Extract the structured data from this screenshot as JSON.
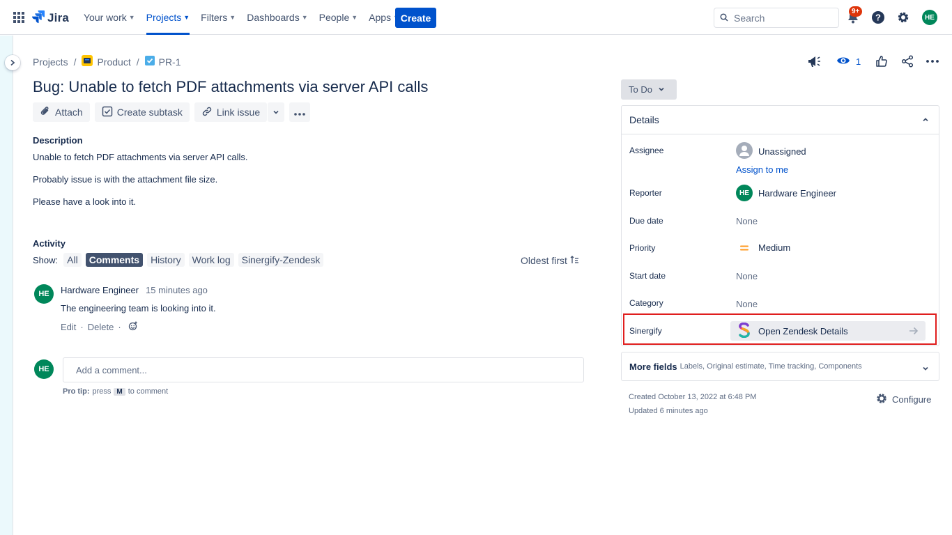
{
  "nav": {
    "logo": "Jira",
    "items": [
      {
        "label": "Your work"
      },
      {
        "label": "Projects"
      },
      {
        "label": "Filters"
      },
      {
        "label": "Dashboards"
      },
      {
        "label": "People"
      },
      {
        "label": "Apps"
      }
    ],
    "create": "Create",
    "search_placeholder": "Search",
    "notification_badge": "9+",
    "user_initials": "HE"
  },
  "breadcrumb": {
    "projects": "Projects",
    "project": "Product",
    "issue_key": "PR-1"
  },
  "issue": {
    "title": "Bug: Unable to fetch PDF attachments via server API calls",
    "toolbar": {
      "attach": "Attach",
      "create_subtask": "Create subtask",
      "link_issue": "Link issue"
    },
    "description_label": "Description",
    "description": [
      "Unable to fetch PDF attachments via server API calls.",
      "Probably issue is with the attachment file size.",
      "Please have a look into it."
    ]
  },
  "activity": {
    "label": "Activity",
    "show_label": "Show:",
    "tabs": [
      "All",
      "Comments",
      "History",
      "Work log",
      "Sinergify-Zendesk"
    ],
    "selected_tab": "Comments",
    "sort": "Oldest first",
    "comment": {
      "initials": "HE",
      "author": "Hardware Engineer",
      "time": "15 minutes ago",
      "text": "The engineering team is looking into it.",
      "edit": "Edit",
      "delete": "Delete",
      "dot": "·"
    },
    "add_comment_placeholder": "Add a comment...",
    "protip_bold": "Pro tip:",
    "protip_press": "press",
    "protip_key": "M",
    "protip_suffix": "to comment"
  },
  "sidebar": {
    "watchers": "1",
    "status": "To Do",
    "details_title": "Details",
    "fields": {
      "assignee_label": "Assignee",
      "assignee_value": "Unassigned",
      "assign_to_me": "Assign to me",
      "reporter_label": "Reporter",
      "reporter_initials": "HE",
      "reporter_value": "Hardware Engineer",
      "due_date_label": "Due date",
      "due_date_value": "None",
      "priority_label": "Priority",
      "priority_value": "Medium",
      "start_date_label": "Start date",
      "start_date_value": "None",
      "category_label": "Category",
      "category_value": "None",
      "sinergify_label": "Sinergify",
      "sinergify_button": "Open Zendesk Details"
    },
    "more_fields_title": "More fields",
    "more_fields_sub": "Labels, Original estimate, Time tracking, Components",
    "created": "Created October 13, 2022 at 6:48 PM",
    "updated": "Updated 6 minutes ago",
    "configure": "Configure"
  },
  "colors": {
    "primary": "#0052cc",
    "avatar_green": "#00875a",
    "highlight_red": "#e01e1e",
    "badge_red": "#de350b",
    "priority_orange": "#ff991f"
  }
}
